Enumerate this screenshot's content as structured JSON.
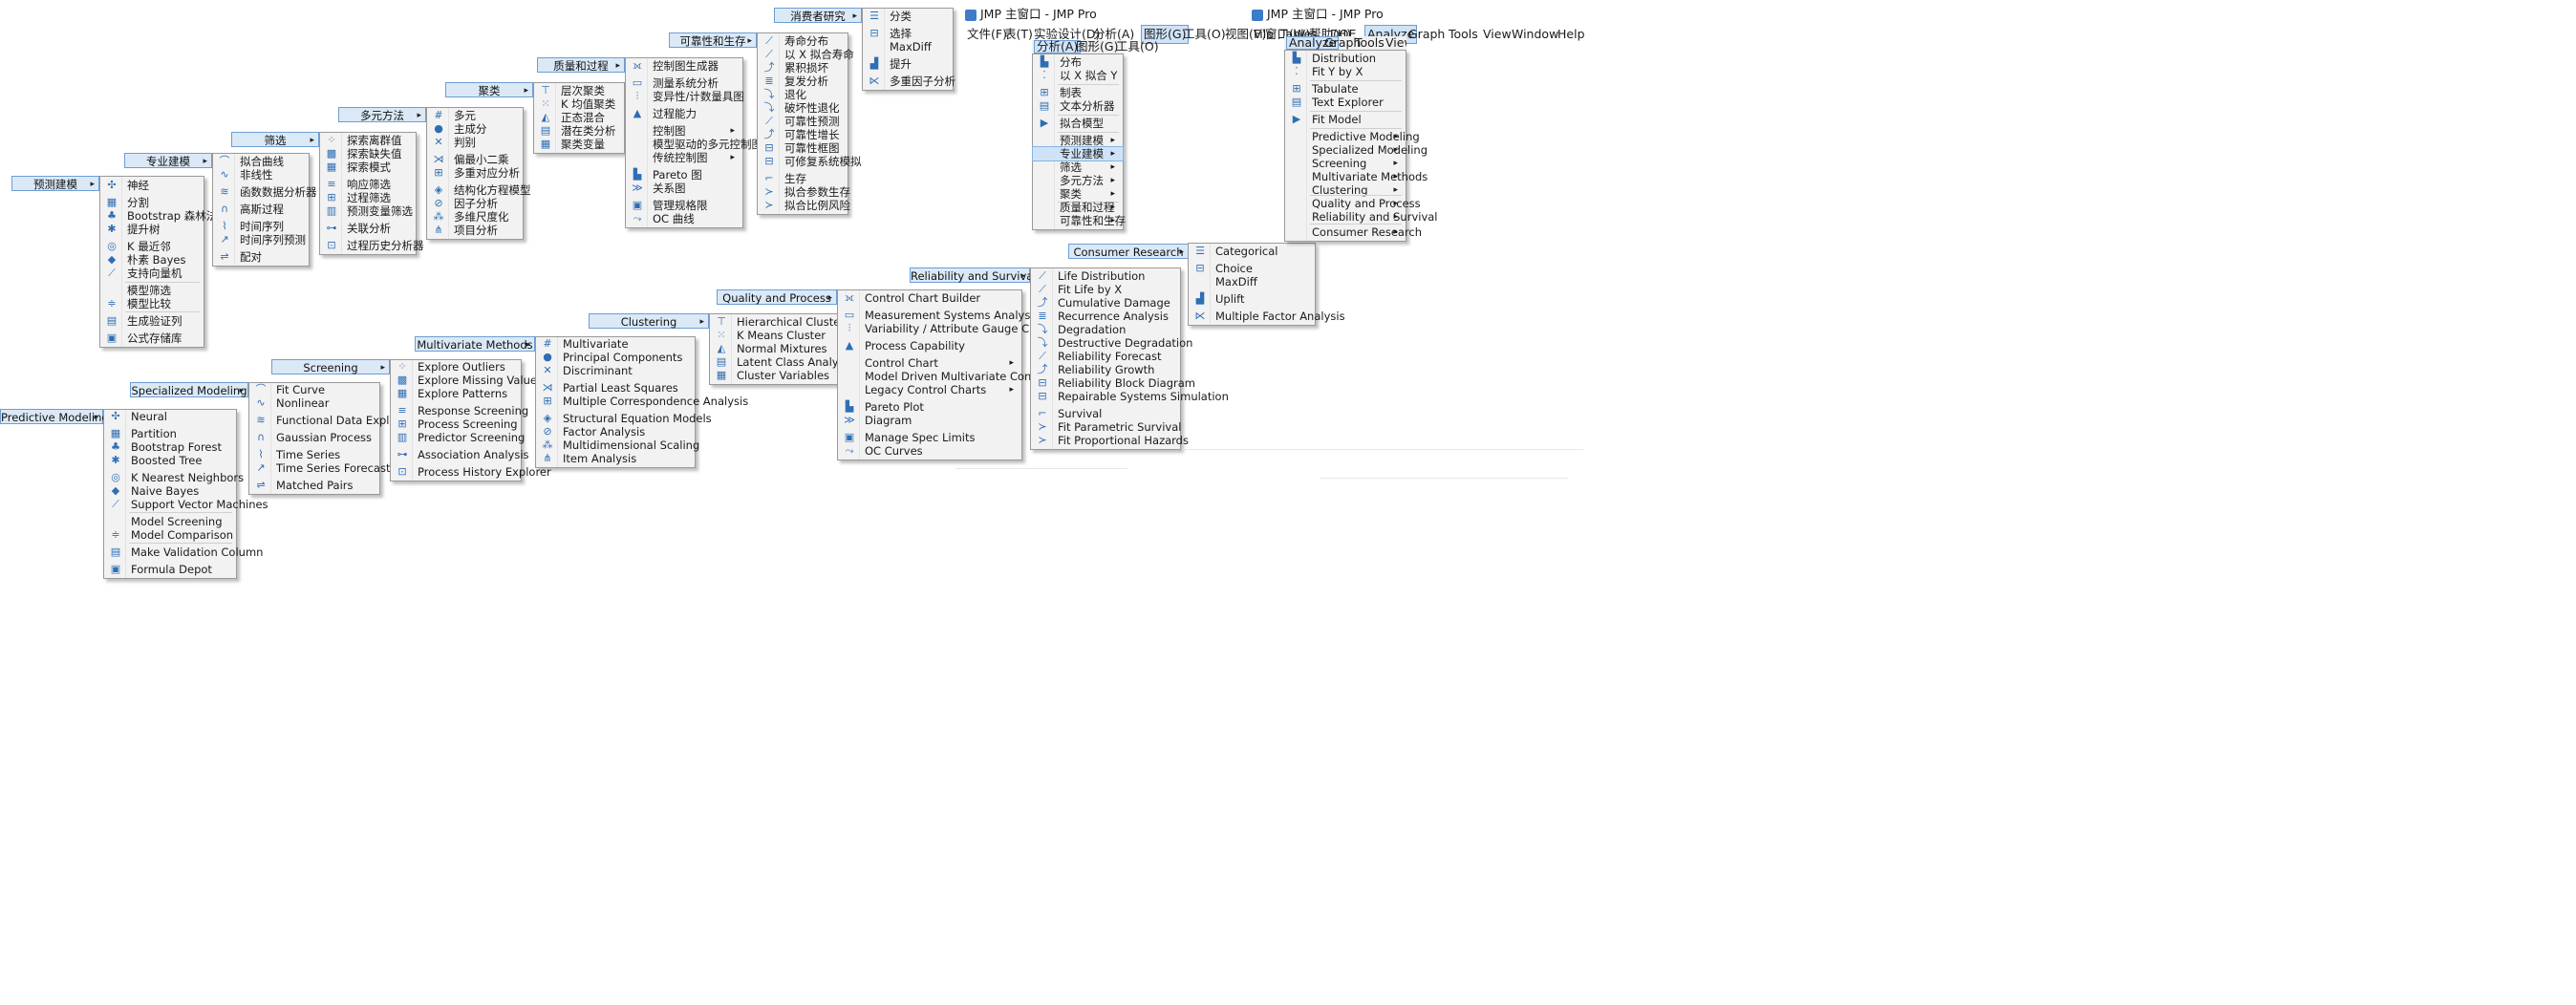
{
  "colors": {
    "accent": "#2f6eb5",
    "highlight": "#cfe3f8",
    "menu_bg": "#f2f2f2",
    "header_bg": "#dbe9f7"
  },
  "cn": {
    "predictive": {
      "header": "预测建模",
      "items": [
        {
          "icon": "neural-icon",
          "label": "神经"
        },
        {
          "icon": "partition-icon",
          "label": "分割"
        },
        {
          "icon": "forest-icon",
          "label": "Bootstrap 森林法"
        },
        {
          "icon": "boosted-tree-icon",
          "label": "提升树"
        },
        {
          "icon": "knn-icon",
          "label": "K 最近邻"
        },
        {
          "icon": "bayes-icon",
          "label": "朴素 Bayes"
        },
        {
          "icon": "svm-icon",
          "label": "支持向量机"
        },
        {
          "icon": "",
          "label": "模型筛选"
        },
        {
          "icon": "compare-icon",
          "label": "模型比较"
        },
        {
          "icon": "validation-icon",
          "label": "生成验证列"
        },
        {
          "icon": "depot-icon",
          "label": "公式存储库"
        }
      ]
    },
    "specialized": {
      "header": "专业建模",
      "items": [
        {
          "icon": "fit-curve-icon",
          "label": "拟合曲线"
        },
        {
          "icon": "nonlinear-icon",
          "label": "非线性"
        },
        {
          "icon": "functional-icon",
          "label": "函数数据分析器"
        },
        {
          "icon": "gaussian-icon",
          "label": "高斯过程"
        },
        {
          "icon": "time-series-icon",
          "label": "时间序列"
        },
        {
          "icon": "forecast-icon",
          "label": "时间序列预测"
        },
        {
          "icon": "matched-pairs-icon",
          "label": "配对"
        }
      ]
    },
    "screening": {
      "header": "筛选",
      "items": [
        {
          "icon": "outliers-icon",
          "label": "探索离群值"
        },
        {
          "icon": "missing-icon",
          "label": "探索缺失值"
        },
        {
          "icon": "patterns-icon",
          "label": "探索模式"
        },
        {
          "icon": "response-icon",
          "label": "响应筛选"
        },
        {
          "icon": "process-screening-icon",
          "label": "过程筛选"
        },
        {
          "icon": "predictor-icon",
          "label": "预测变量筛选"
        },
        {
          "icon": "association-icon",
          "label": "关联分析"
        },
        {
          "icon": "history-icon",
          "label": "过程历史分析器"
        }
      ]
    },
    "multivariate": {
      "header": "多元方法",
      "items": [
        {
          "icon": "multivariate-icon",
          "label": "多元"
        },
        {
          "icon": "pca-icon",
          "label": "主成分"
        },
        {
          "icon": "discriminant-icon",
          "label": "判别"
        },
        {
          "icon": "pls-icon",
          "label": "偏最小二乘"
        },
        {
          "icon": "mca-icon",
          "label": "多重对应分析"
        },
        {
          "icon": "sem-icon",
          "label": "结构化方程模型"
        },
        {
          "icon": "factor-icon",
          "label": "因子分析"
        },
        {
          "icon": "mds-icon",
          "label": "多维尺度化"
        },
        {
          "icon": "item-icon",
          "label": "项目分析"
        }
      ]
    },
    "clustering": {
      "header": "聚类",
      "items": [
        {
          "icon": "hier-icon",
          "label": "层次聚类"
        },
        {
          "icon": "kmeans-icon",
          "label": "K 均值聚类"
        },
        {
          "icon": "normal-mix-icon",
          "label": "正态混合"
        },
        {
          "icon": "latent-icon",
          "label": "潜在类分析"
        },
        {
          "icon": "cluster-var-icon",
          "label": "聚类变量"
        }
      ]
    },
    "quality": {
      "header": "质量和过程",
      "items": [
        {
          "icon": "ccb-icon",
          "label": "控制图生成器",
          "sub": false
        },
        {
          "icon": "msa-icon",
          "label": "测量系统分析",
          "sub": false
        },
        {
          "icon": "gauge-icon",
          "label": "变异性/计数量具图",
          "sub": false
        },
        {
          "icon": "capability-icon",
          "label": "过程能力",
          "sub": false
        },
        {
          "icon": "",
          "label": "控制图",
          "sub": true
        },
        {
          "icon": "",
          "label": "模型驱动的多元控制图",
          "sub": false
        },
        {
          "icon": "",
          "label": "传统控制图",
          "sub": true
        },
        {
          "icon": "pareto-icon",
          "label": "Pareto 图",
          "sub": false
        },
        {
          "icon": "diagram-icon",
          "label": "关系图",
          "sub": false
        },
        {
          "icon": "spec-icon",
          "label": "管理规格限",
          "sub": false
        },
        {
          "icon": "oc-icon",
          "label": "OC 曲线",
          "sub": false
        }
      ]
    },
    "reliability": {
      "header": "可靠性和生存",
      "items": [
        {
          "icon": "life-icon",
          "label": "寿命分布"
        },
        {
          "icon": "fitlife-icon",
          "label": "以 X 拟合寿命"
        },
        {
          "icon": "damage-icon",
          "label": "累积损坏"
        },
        {
          "icon": "recurrence-icon",
          "label": "复发分析"
        },
        {
          "icon": "degradation-icon",
          "label": "退化"
        },
        {
          "icon": "destructive-icon",
          "label": "破坏性退化"
        },
        {
          "icon": "rel-forecast-icon",
          "label": "可靠性预测"
        },
        {
          "icon": "rel-growth-icon",
          "label": "可靠性增长"
        },
        {
          "icon": "block-icon",
          "label": "可靠性框图"
        },
        {
          "icon": "repairable-icon",
          "label": "可修复系统模拟"
        },
        {
          "icon": "survival-icon",
          "label": "生存"
        },
        {
          "icon": "parametric-icon",
          "label": "拟合参数生存"
        },
        {
          "icon": "hazards-icon",
          "label": "拟合比例风险"
        }
      ]
    },
    "consumer": {
      "header": "消费者研究",
      "items": [
        {
          "icon": "categorical-icon",
          "label": "分类"
        },
        {
          "icon": "choice-icon",
          "label": "选择"
        },
        {
          "icon": "",
          "label": "MaxDiff"
        },
        {
          "icon": "uplift-icon",
          "label": "提升"
        },
        {
          "icon": "mfa-icon",
          "label": "多重因子分析"
        }
      ]
    },
    "window": {
      "title": "JMP 主窗口 - JMP Pro",
      "menubar": [
        "文件(F)",
        "表(T)",
        "实验设计(D)",
        "分析(A)",
        "图形(G)",
        "工具(O)",
        "视图(V)",
        "窗口(W)",
        "帮助(H)"
      ],
      "strip": [
        "分析(A)",
        "图形(G)",
        "工具(O)"
      ]
    },
    "analyze": {
      "items": [
        {
          "icon": "distribution-icon",
          "label": "分布",
          "sub": false
        },
        {
          "icon": "fit-y-icon",
          "label": "以 X 拟合 Y",
          "sub": false
        },
        {
          "icon": "tabulate-icon",
          "label": "制表",
          "sub": false
        },
        {
          "icon": "text-icon",
          "label": "文本分析器",
          "sub": false
        },
        {
          "icon": "fit-model-icon",
          "label": "拟合模型",
          "sub": false
        },
        {
          "icon": "",
          "label": "预测建模",
          "sub": true
        },
        {
          "icon": "",
          "label": "专业建模",
          "sub": true
        },
        {
          "icon": "",
          "label": "筛选",
          "sub": true
        },
        {
          "icon": "",
          "label": "多元方法",
          "sub": true
        },
        {
          "icon": "",
          "label": "聚类",
          "sub": true
        },
        {
          "icon": "",
          "label": "质量和过程",
          "sub": true
        },
        {
          "icon": "",
          "label": "可靠性和生存",
          "sub": true
        }
      ]
    }
  },
  "en": {
    "predictive": {
      "header": "Predictive Modeling",
      "items": [
        {
          "icon": "neural-icon",
          "label": "Neural"
        },
        {
          "icon": "partition-icon",
          "label": "Partition"
        },
        {
          "icon": "forest-icon",
          "label": "Bootstrap Forest"
        },
        {
          "icon": "boosted-tree-icon",
          "label": "Boosted Tree"
        },
        {
          "icon": "knn-icon",
          "label": "K Nearest Neighbors"
        },
        {
          "icon": "bayes-icon",
          "label": "Naive Bayes"
        },
        {
          "icon": "svm-icon",
          "label": "Support Vector Machines"
        },
        {
          "icon": "",
          "label": "Model Screening"
        },
        {
          "icon": "compare-icon",
          "label": "Model Comparison"
        },
        {
          "icon": "validation-icon",
          "label": "Make Validation Column"
        },
        {
          "icon": "depot-icon",
          "label": "Formula Depot"
        }
      ]
    },
    "specialized": {
      "header": "Specialized Modeling",
      "items": [
        {
          "icon": "fit-curve-icon",
          "label": "Fit Curve"
        },
        {
          "icon": "nonlinear-icon",
          "label": "Nonlinear"
        },
        {
          "icon": "functional-icon",
          "label": "Functional Data Explorer"
        },
        {
          "icon": "gaussian-icon",
          "label": "Gaussian Process"
        },
        {
          "icon": "time-series-icon",
          "label": "Time Series"
        },
        {
          "icon": "forecast-icon",
          "label": "Time Series Forecast"
        },
        {
          "icon": "matched-pairs-icon",
          "label": "Matched Pairs"
        }
      ]
    },
    "screening": {
      "header": "Screening",
      "items": [
        {
          "icon": "outliers-icon",
          "label": "Explore Outliers"
        },
        {
          "icon": "missing-icon",
          "label": "Explore Missing Values"
        },
        {
          "icon": "patterns-icon",
          "label": "Explore Patterns"
        },
        {
          "icon": "response-icon",
          "label": "Response Screening"
        },
        {
          "icon": "process-screening-icon",
          "label": "Process Screening"
        },
        {
          "icon": "predictor-icon",
          "label": "Predictor Screening"
        },
        {
          "icon": "association-icon",
          "label": "Association Analysis"
        },
        {
          "icon": "history-icon",
          "label": "Process History Explorer"
        }
      ]
    },
    "multivariate": {
      "header": "Multivariate Methods",
      "items": [
        {
          "icon": "multivariate-icon",
          "label": "Multivariate"
        },
        {
          "icon": "pca-icon",
          "label": "Principal Components"
        },
        {
          "icon": "discriminant-icon",
          "label": "Discriminant"
        },
        {
          "icon": "pls-icon",
          "label": "Partial Least Squares"
        },
        {
          "icon": "mca-icon",
          "label": "Multiple Correspondence Analysis"
        },
        {
          "icon": "sem-icon",
          "label": "Structural Equation Models"
        },
        {
          "icon": "factor-icon",
          "label": "Factor Analysis"
        },
        {
          "icon": "mds-icon",
          "label": "Multidimensional Scaling"
        },
        {
          "icon": "item-icon",
          "label": "Item Analysis"
        }
      ]
    },
    "clustering": {
      "header": "Clustering",
      "items": [
        {
          "icon": "hier-icon",
          "label": "Hierarchical Cluster"
        },
        {
          "icon": "kmeans-icon",
          "label": "K Means Cluster"
        },
        {
          "icon": "normal-mix-icon",
          "label": "Normal Mixtures"
        },
        {
          "icon": "latent-icon",
          "label": "Latent Class Analysis"
        },
        {
          "icon": "cluster-var-icon",
          "label": "Cluster Variables"
        }
      ]
    },
    "quality": {
      "header": "Quality and Process",
      "items": [
        {
          "icon": "ccb-icon",
          "label": "Control Chart Builder",
          "sub": false
        },
        {
          "icon": "msa-icon",
          "label": "Measurement Systems Analysis",
          "sub": false
        },
        {
          "icon": "gauge-icon",
          "label": "Variability / Attribute Gauge Chart",
          "sub": false
        },
        {
          "icon": "capability-icon",
          "label": "Process Capability",
          "sub": false
        },
        {
          "icon": "",
          "label": "Control Chart",
          "sub": true
        },
        {
          "icon": "",
          "label": "Model Driven Multivariate Control Chart",
          "sub": false
        },
        {
          "icon": "",
          "label": "Legacy Control Charts",
          "sub": true
        },
        {
          "icon": "pareto-icon",
          "label": "Pareto Plot",
          "sub": false
        },
        {
          "icon": "diagram-icon",
          "label": "Diagram",
          "sub": false
        },
        {
          "icon": "spec-icon",
          "label": "Manage Spec Limits",
          "sub": false
        },
        {
          "icon": "oc-icon",
          "label": "OC Curves",
          "sub": false
        }
      ]
    },
    "reliability": {
      "header": "Reliability and Survival",
      "items": [
        {
          "icon": "life-icon",
          "label": "Life Distribution"
        },
        {
          "icon": "fitlife-icon",
          "label": "Fit Life by X"
        },
        {
          "icon": "damage-icon",
          "label": "Cumulative Damage"
        },
        {
          "icon": "recurrence-icon",
          "label": "Recurrence Analysis"
        },
        {
          "icon": "degradation-icon",
          "label": "Degradation"
        },
        {
          "icon": "destructive-icon",
          "label": "Destructive Degradation"
        },
        {
          "icon": "rel-forecast-icon",
          "label": "Reliability Forecast"
        },
        {
          "icon": "rel-growth-icon",
          "label": "Reliability Growth"
        },
        {
          "icon": "block-icon",
          "label": "Reliability Block Diagram"
        },
        {
          "icon": "repairable-icon",
          "label": "Repairable Systems Simulation"
        },
        {
          "icon": "survival-icon",
          "label": "Survival"
        },
        {
          "icon": "parametric-icon",
          "label": "Fit Parametric Survival"
        },
        {
          "icon": "hazards-icon",
          "label": "Fit Proportional Hazards"
        }
      ]
    },
    "consumer": {
      "header": "Consumer Research",
      "items": [
        {
          "icon": "categorical-icon",
          "label": "Categorical"
        },
        {
          "icon": "choice-icon",
          "label": "Choice"
        },
        {
          "icon": "",
          "label": "MaxDiff"
        },
        {
          "icon": "uplift-icon",
          "label": "Uplift"
        },
        {
          "icon": "mfa-icon",
          "label": "Multiple Factor Analysis"
        }
      ]
    },
    "window": {
      "title": "JMP 主窗口 - JMP Pro",
      "menubar": [
        "File",
        "Tables",
        "DOE",
        "Analyze",
        "Graph",
        "Tools",
        "View",
        "Window",
        "Help"
      ],
      "strip": [
        "Analyze",
        "Graph",
        "Tools",
        "View",
        "Wind"
      ]
    },
    "analyze": {
      "items": [
        {
          "icon": "distribution-icon",
          "label": "Distribution",
          "sub": false
        },
        {
          "icon": "fit-y-icon",
          "label": "Fit Y by X",
          "sub": false
        },
        {
          "icon": "tabulate-icon",
          "label": "Tabulate",
          "sub": false
        },
        {
          "icon": "text-icon",
          "label": "Text Explorer",
          "sub": false
        },
        {
          "icon": "fit-model-icon",
          "label": "Fit Model",
          "sub": false
        },
        {
          "icon": "",
          "label": "Predictive Modeling",
          "sub": true
        },
        {
          "icon": "",
          "label": "Specialized Modeling",
          "sub": true
        },
        {
          "icon": "",
          "label": "Screening",
          "sub": true
        },
        {
          "icon": "",
          "label": "Multivariate Methods",
          "sub": true
        },
        {
          "icon": "",
          "label": "Clustering",
          "sub": true
        },
        {
          "icon": "",
          "label": "Quality and Process",
          "sub": true
        },
        {
          "icon": "",
          "label": "Reliability and Survival",
          "sub": true
        },
        {
          "icon": "",
          "label": "Consumer Research",
          "sub": true
        }
      ]
    }
  }
}
